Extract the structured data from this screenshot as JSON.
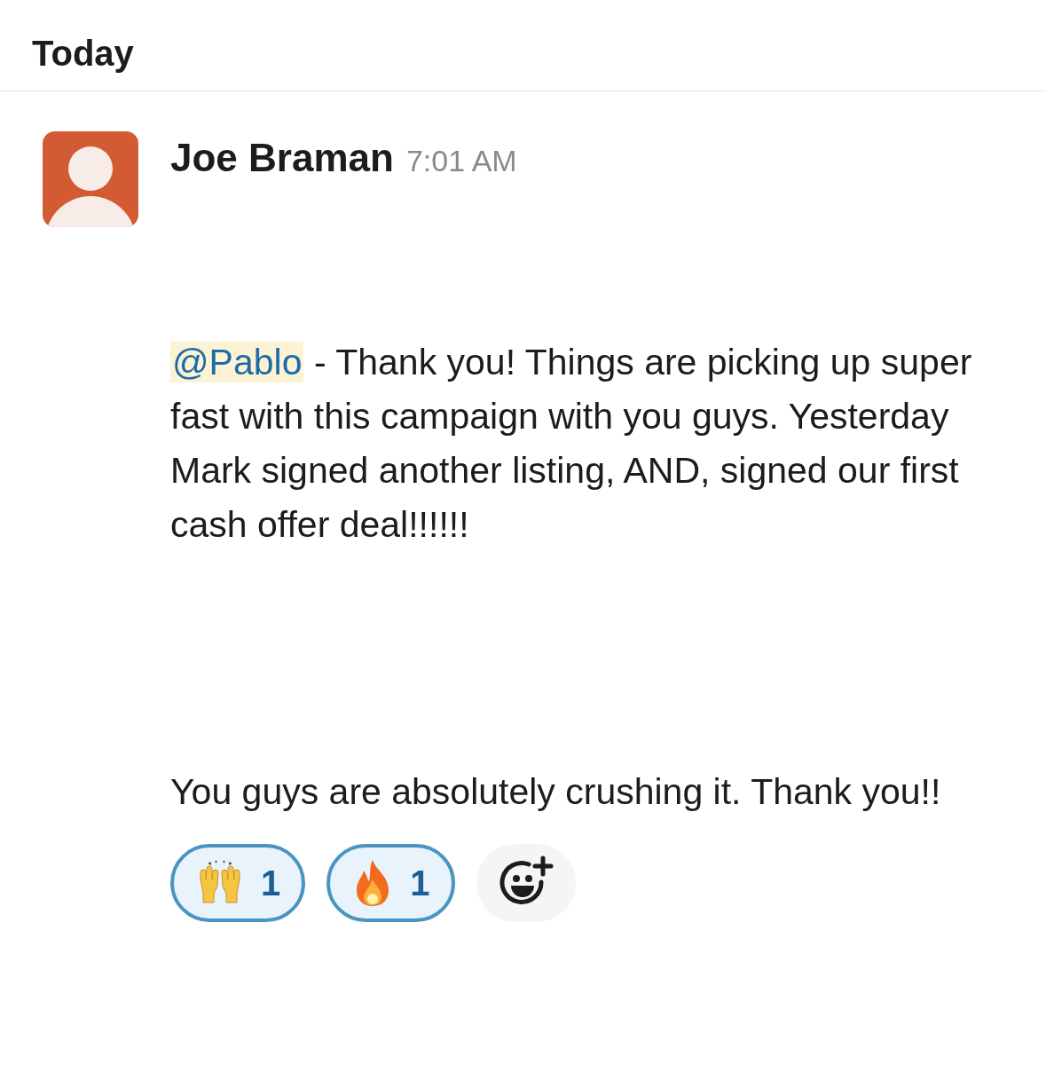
{
  "day_header": "Today",
  "message": {
    "author": "Joe Braman",
    "time": "7:01 AM",
    "paragraphs": [
      {
        "mention": "@Pablo",
        "text": "- Thank you! Things are picking up super fast with this campaign with you guys. Yesterday Mark signed another listing, AND, signed our first cash offer deal!!!!!!"
      },
      {
        "text": "You guys are absolutely crushing it. Thank you!!"
      }
    ],
    "reactions": [
      {
        "kind": "raised-hands",
        "count": "1",
        "selected": true
      },
      {
        "kind": "fire",
        "count": "1",
        "selected": true
      }
    ]
  }
}
